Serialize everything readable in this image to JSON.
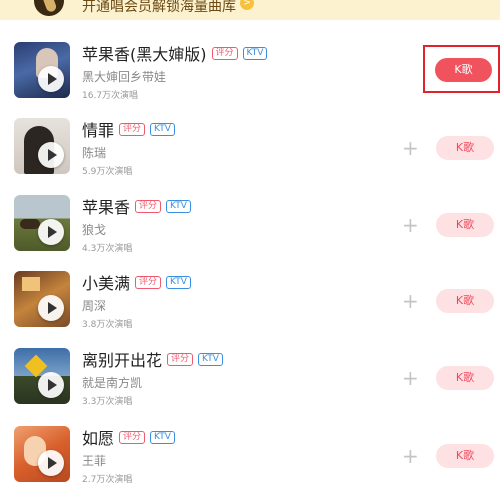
{
  "banner": {
    "text": "开通唱会员解锁海量曲库",
    "badge": ">"
  },
  "songs": [
    {
      "title": "苹果香(黑大婶版)",
      "artist": "黑大婶回乡带娃",
      "plays": "16.7万次演唱",
      "tag_score": "评分",
      "tag_ktv": "KTV",
      "button": "K歌",
      "plus": "+"
    },
    {
      "title": "情罪",
      "artist": "陈瑞",
      "plays": "5.9万次演唱",
      "tag_score": "评分",
      "tag_ktv": "KTV",
      "button": "K歌",
      "plus": "+"
    },
    {
      "title": "苹果香",
      "artist": "狼戈",
      "plays": "4.3万次演唱",
      "tag_score": "评分",
      "tag_ktv": "KTV",
      "button": "K歌",
      "plus": "+"
    },
    {
      "title": "小美满",
      "artist": "周深",
      "plays": "3.8万次演唱",
      "tag_score": "评分",
      "tag_ktv": "KTV",
      "button": "K歌",
      "plus": "+"
    },
    {
      "title": "离别开出花",
      "artist": "就是南方凯",
      "plays": "3.3万次演唱",
      "tag_score": "评分",
      "tag_ktv": "KTV",
      "button": "K歌",
      "plus": "+"
    },
    {
      "title": "如愿",
      "artist": "王菲",
      "plays": "2.7万次演唱",
      "tag_score": "评分",
      "tag_ktv": "KTV",
      "button": "K歌",
      "plus": "+"
    }
  ]
}
